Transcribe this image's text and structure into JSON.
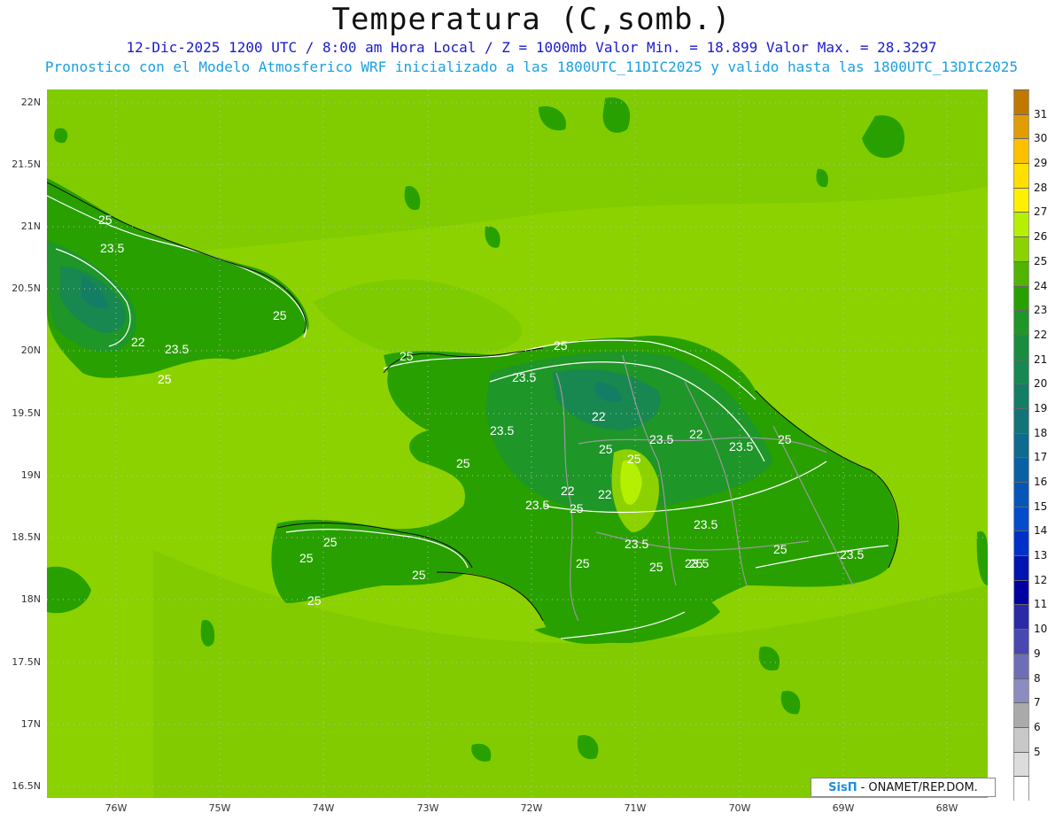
{
  "title": "Temperatura (C,somb.)",
  "subtitle_line1": "12-Dic-2025  1200 UTC / 8:00 am Hora Local / Z = 1000mb    Valor Min. = 18.899  Valor Max. = 28.3297",
  "subtitle_line2": "Pronostico con el Modelo Atmosferico WRF inicializado a las 1800UTC_11DIC2025 y valido hasta las  1800UTC_13DIC2025",
  "lat_labels": [
    "22N",
    "21.5N",
    "21N",
    "20.5N",
    "20N",
    "19.5N",
    "19N",
    "18.5N",
    "18N",
    "17.5N",
    "17N",
    "16.5N"
  ],
  "lon_labels": [
    "76W",
    "75W",
    "74W",
    "73W",
    "72W",
    "71W",
    "70W",
    "69W",
    "68W"
  ],
  "colorbar": {
    "labels": [
      "31",
      "30",
      "29",
      "28",
      "27",
      "26",
      "25",
      "24",
      "23",
      "22",
      "21",
      "20",
      "19",
      "18",
      "17",
      "16",
      "15",
      "14",
      "13",
      "12",
      "11",
      "10",
      "9",
      "8",
      "7",
      "6",
      "5"
    ],
    "colors": [
      "#c07800",
      "#e09c00",
      "#ffc000",
      "#ffe000",
      "#fff000",
      "#b4f000",
      "#8cd200",
      "#50b400",
      "#28a000",
      "#1e9628",
      "#1a8c40",
      "#188850",
      "#147e64",
      "#127478",
      "#0e6a8e",
      "#0a60a4",
      "#0656ba",
      "#034ccc",
      "#0030c8",
      "#0014b4",
      "#0000a0",
      "#2a2aa8",
      "#4848b0",
      "#6e6eb8",
      "#8c8cc0",
      "#aaaaaa",
      "#c8c8c8",
      "#dcdcdc",
      "#ffffff"
    ]
  },
  "contour_labels": [
    "25",
    "23.5",
    "25",
    "22",
    "23.5",
    "25",
    "25",
    "25",
    "23.5",
    "22",
    "23.5",
    "25",
    "25",
    "23.5",
    "22",
    "23.5",
    "22",
    "23.5",
    "25",
    "25",
    "22",
    "23.5",
    "25",
    "23.5",
    "25",
    "25",
    "23.5",
    "23.5",
    "25",
    "25",
    "25",
    "25",
    "25",
    "25"
  ],
  "credit": {
    "logo": "SisΠ",
    "text": "- ONAMET/REP.DOM."
  },
  "chart_data": {
    "type": "heatmap",
    "variable": "Temperatura (C,somb.)",
    "level": "Z = 1000mb",
    "valid_time": "12-Dic-2025 1200 UTC",
    "min_value": 18.899,
    "max_value": 28.3297,
    "lat_range": [
      16.4,
      22.1
    ],
    "lon_range": [
      -76.65,
      -67.6
    ],
    "contour_levels": [
      22,
      23.5,
      25
    ]
  }
}
